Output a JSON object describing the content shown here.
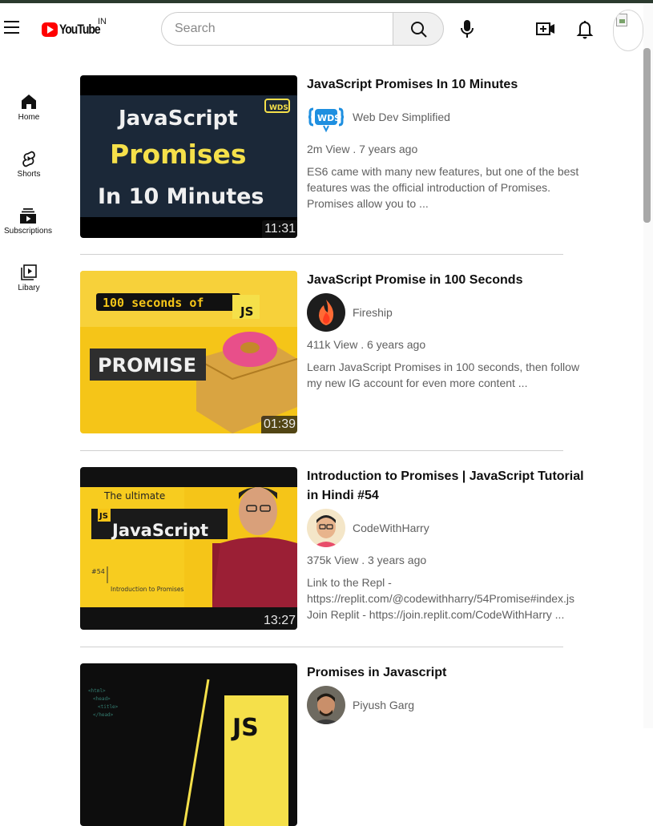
{
  "header": {
    "logo_text": "YouTube",
    "region": "IN",
    "search_placeholder": "Search"
  },
  "sidebar": {
    "items": [
      {
        "label": "Home",
        "icon": "home-icon"
      },
      {
        "label": "Shorts",
        "icon": "shorts-icon"
      },
      {
        "label": "Subscriptions",
        "icon": "subscriptions-icon"
      },
      {
        "label": "Libary",
        "icon": "library-icon"
      }
    ]
  },
  "videos": [
    {
      "title": "JavaScript Promises In 10 Minutes",
      "channel": "Web Dev Simplified",
      "meta": "2m View . 7 years ago",
      "description": "ES6 came with many new features, but one of the best features was the official introduction of Promises. Promises allow you to ...",
      "duration": "11:31",
      "thumb_text": [
        "JavaScript",
        "Promises",
        "In 10 Minutes"
      ],
      "thumb_badge": "WDS"
    },
    {
      "title": "JavaScript Promise in 100 Seconds",
      "channel": "Fireship",
      "meta": "411k View . 6 years ago",
      "description": "Learn JavaScript Promises in 100 seconds, then follow my new IG account for even more content ...",
      "duration": "01:39",
      "thumb_text": [
        "100 seconds of",
        "JS",
        "PROMISE"
      ]
    },
    {
      "title": "Introduction to Promises | JavaScript Tutorial in Hindi #54",
      "channel": "CodeWithHarry",
      "meta": "375k View . 3 years ago",
      "description": "Link to the Repl - https://replit.com/@codewithharry/54Promise#index.js Join Replit - https://join.replit.com/CodeWithHarry ...",
      "duration": "13:27",
      "thumb_text": [
        "The ultimate",
        "JavaScript",
        "JS",
        "#54",
        "Introduction to Promises"
      ]
    },
    {
      "title": "Promises in Javascript",
      "channel": "Piyush Garg",
      "meta": "",
      "description": "",
      "duration": "",
      "thumb_text": [
        "JS"
      ]
    }
  ],
  "colors": {
    "brand_red": "#ff0000",
    "text_primary": "#0f0f0f",
    "text_secondary": "#606060"
  }
}
